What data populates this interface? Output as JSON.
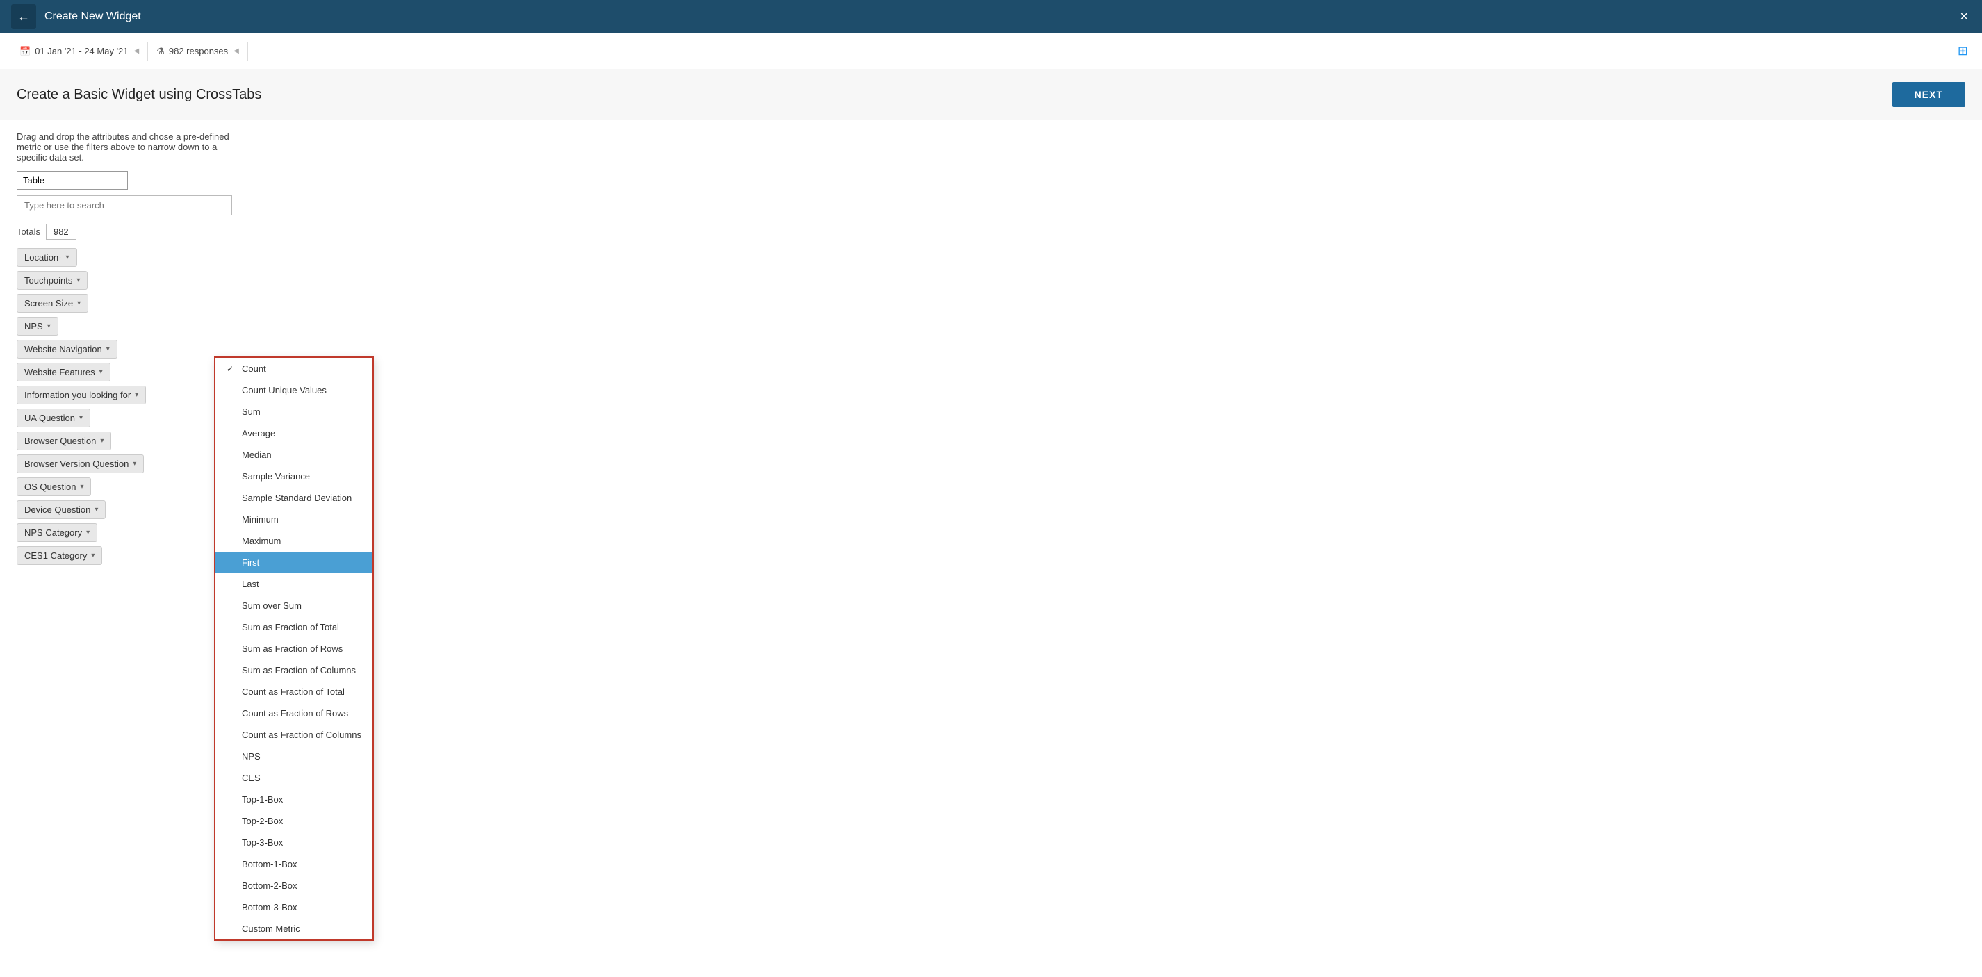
{
  "header": {
    "title": "Create New Widget",
    "back_label": "←",
    "close_label": "×"
  },
  "filter_bar": {
    "date_range": "01 Jan '21 - 24 May '21",
    "responses": "982 responses",
    "collapse_arrow": "◀"
  },
  "sub_header": {
    "title": "Create a Basic Widget using CrossTabs",
    "next_button": "NEXT"
  },
  "instructions": "Drag and drop the attributes and chose a pre-defined metric or use the filters above to narrow down to a specific data set.",
  "table_select": "Table",
  "search_placeholder": "Type here to search",
  "totals_label": "Totals",
  "totals_value": "982",
  "attributes": [
    {
      "label": "Location-",
      "has_dropdown": true
    },
    {
      "label": "Touchpoints",
      "has_dropdown": true
    },
    {
      "label": "Screen Size",
      "has_dropdown": true
    },
    {
      "label": "NPS",
      "has_dropdown": true
    },
    {
      "label": "Website Navigation",
      "has_dropdown": true
    },
    {
      "label": "Website Features",
      "has_dropdown": true
    },
    {
      "label": "Information you looking for",
      "has_dropdown": true
    },
    {
      "label": "UA Question",
      "has_dropdown": true
    },
    {
      "label": "Browser Question",
      "has_dropdown": true
    },
    {
      "label": "Browser Version Question",
      "has_dropdown": true
    },
    {
      "label": "OS Question",
      "has_dropdown": true
    },
    {
      "label": "Device Question",
      "has_dropdown": true
    },
    {
      "label": "NPS Category",
      "has_dropdown": true
    },
    {
      "label": "CES1 Category",
      "has_dropdown": true
    }
  ],
  "dropdown": {
    "items": [
      {
        "label": "Count",
        "selected": false,
        "checked": true
      },
      {
        "label": "Count Unique Values",
        "selected": false,
        "checked": false
      },
      {
        "label": "Sum",
        "selected": false,
        "checked": false
      },
      {
        "label": "Average",
        "selected": false,
        "checked": false
      },
      {
        "label": "Median",
        "selected": false,
        "checked": false
      },
      {
        "label": "Sample Variance",
        "selected": false,
        "checked": false
      },
      {
        "label": "Sample Standard Deviation",
        "selected": false,
        "checked": false
      },
      {
        "label": "Minimum",
        "selected": false,
        "checked": false
      },
      {
        "label": "Maximum",
        "selected": false,
        "checked": false
      },
      {
        "label": "First",
        "selected": true,
        "checked": false
      },
      {
        "label": "Last",
        "selected": false,
        "checked": false
      },
      {
        "label": "Sum over Sum",
        "selected": false,
        "checked": false
      },
      {
        "label": "Sum as Fraction of Total",
        "selected": false,
        "checked": false
      },
      {
        "label": "Sum as Fraction of Rows",
        "selected": false,
        "checked": false
      },
      {
        "label": "Sum as Fraction of Columns",
        "selected": false,
        "checked": false
      },
      {
        "label": "Count as Fraction of Total",
        "selected": false,
        "checked": false
      },
      {
        "label": "Count as Fraction of Rows",
        "selected": false,
        "checked": false
      },
      {
        "label": "Count as Fraction of Columns",
        "selected": false,
        "checked": false
      },
      {
        "label": "NPS",
        "selected": false,
        "checked": false
      },
      {
        "label": "CES",
        "selected": false,
        "checked": false
      },
      {
        "label": "Top-1-Box",
        "selected": false,
        "checked": false
      },
      {
        "label": "Top-2-Box",
        "selected": false,
        "checked": false
      },
      {
        "label": "Top-3-Box",
        "selected": false,
        "checked": false
      },
      {
        "label": "Bottom-1-Box",
        "selected": false,
        "checked": false
      },
      {
        "label": "Bottom-2-Box",
        "selected": false,
        "checked": false
      },
      {
        "label": "Bottom-3-Box",
        "selected": false,
        "checked": false
      },
      {
        "label": "Custom Metric",
        "selected": false,
        "checked": false
      }
    ]
  }
}
